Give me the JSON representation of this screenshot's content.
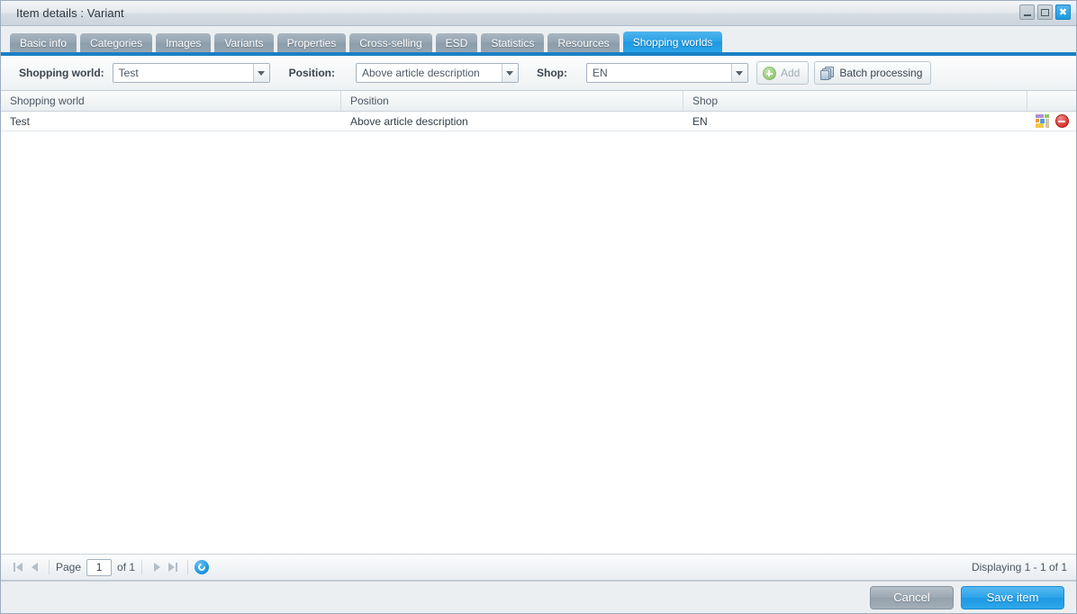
{
  "window": {
    "title": "Item details : Variant",
    "controls": {
      "minimize": "minimize",
      "maximize": "maximize",
      "close": "✖"
    }
  },
  "tabs": [
    {
      "label": "Basic info",
      "active": false
    },
    {
      "label": "Categories",
      "active": false
    },
    {
      "label": "Images",
      "active": false
    },
    {
      "label": "Variants",
      "active": false
    },
    {
      "label": "Properties",
      "active": false
    },
    {
      "label": "Cross-selling",
      "active": false
    },
    {
      "label": "ESD",
      "active": false
    },
    {
      "label": "Statistics",
      "active": false
    },
    {
      "label": "Resources",
      "active": false
    },
    {
      "label": "Shopping worlds",
      "active": true
    }
  ],
  "toolbar": {
    "shopping_world_label": "Shopping world:",
    "shopping_world_value": "Test",
    "position_label": "Position:",
    "position_value": "Above article description",
    "shop_label": "Shop:",
    "shop_value": "EN",
    "add_label": "Add",
    "batch_label": "Batch processing"
  },
  "grid": {
    "columns": [
      "Shopping world",
      "Position",
      "Shop",
      ""
    ],
    "rows": [
      {
        "shopping_world": "Test",
        "position": "Above article description",
        "shop": "EN"
      }
    ]
  },
  "pager": {
    "page_label": "Page",
    "page_value": "1",
    "of_label": "of 1",
    "displaying": "Displaying 1 - 1 of 1"
  },
  "footer": {
    "cancel_label": "Cancel",
    "save_label": "Save item"
  },
  "colors": {
    "accent_blue": "#1a7fc4",
    "active_tab": "#28a1e6",
    "save_button": "#2aa3e8",
    "cancel_button": "#9ba7b1",
    "delete_icon": "#d9392f",
    "add_icon": "#7cbd52"
  }
}
